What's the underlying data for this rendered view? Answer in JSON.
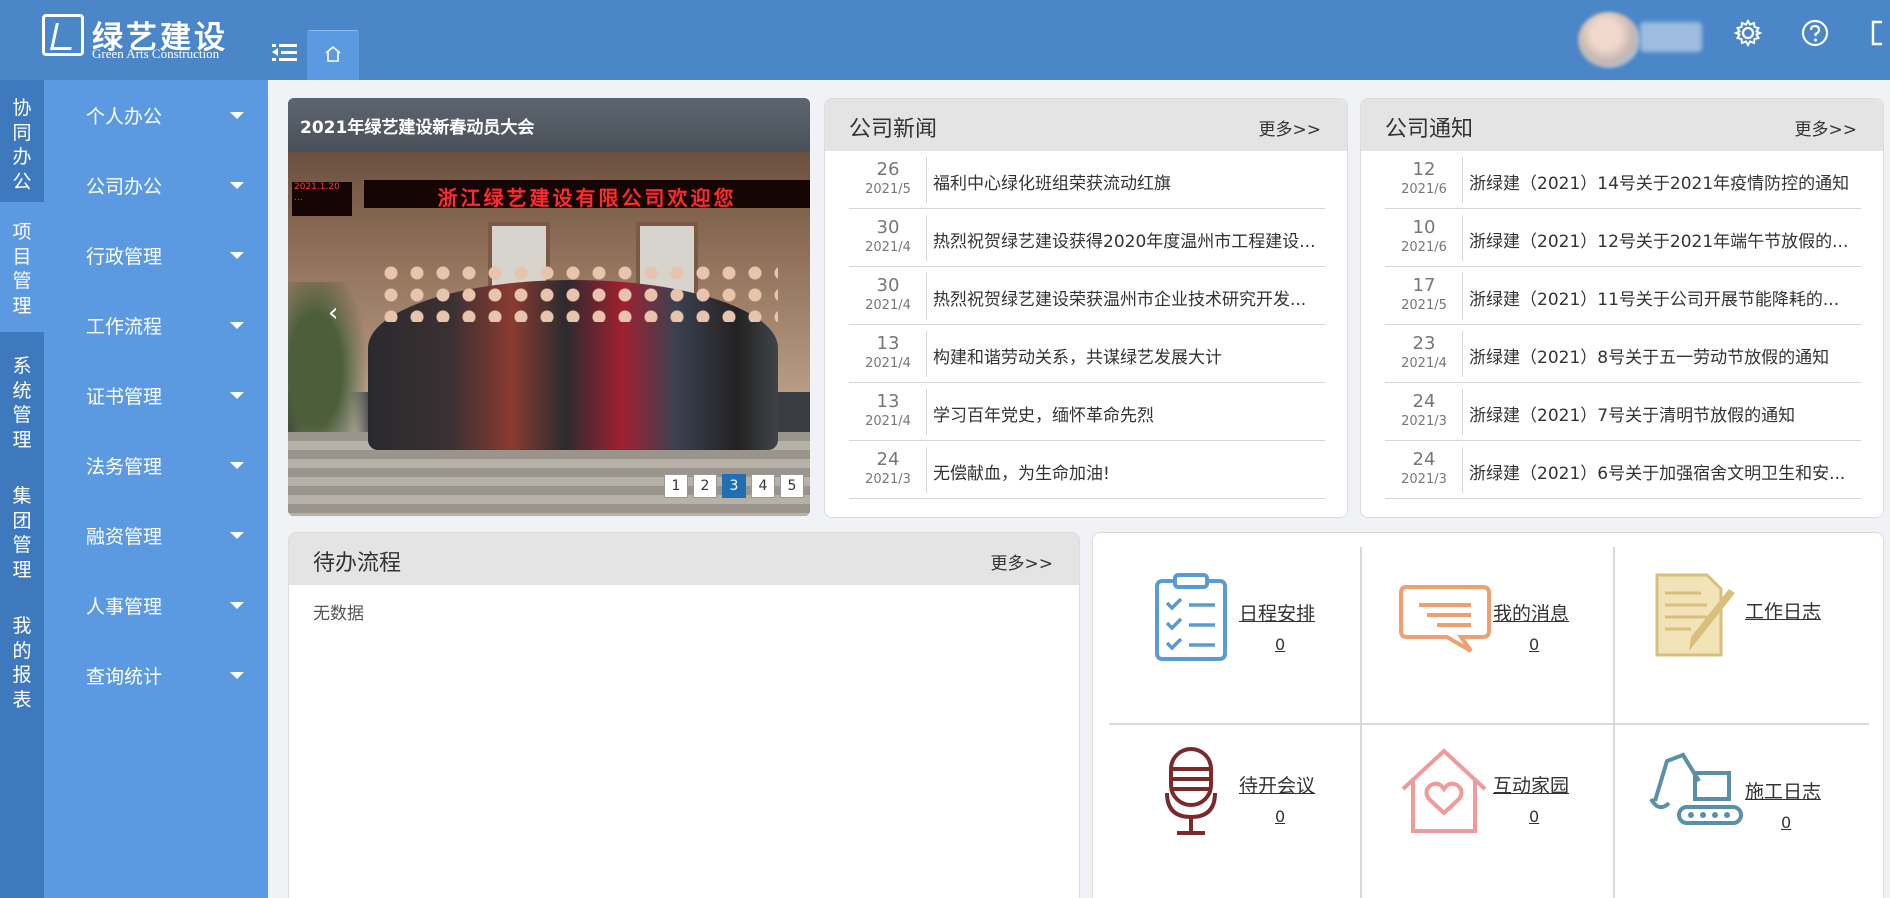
{
  "header": {
    "logo_cn": "绿艺建设",
    "logo_en": "Green Arts Construction",
    "home_tab_icon": "home-icon"
  },
  "left_nav": [
    "协同办公",
    "项目管理",
    "系统管理",
    "集团管理",
    "我的报表"
  ],
  "sub_nav": [
    "个人办公",
    "公司办公",
    "行政管理",
    "工作流程",
    "证书管理",
    "法务管理",
    "融资管理",
    "人事管理",
    "查询统计"
  ],
  "carousel": {
    "title": "2021年绿艺建设新春动员大会",
    "banner": "浙江绿艺建设有限公司欢迎您",
    "small_banner": "2021.1.20 ...",
    "pages": [
      "1",
      "2",
      "3",
      "4",
      "5"
    ],
    "active_page": 3
  },
  "news": {
    "title": "公司新闻",
    "more": "更多>>",
    "items": [
      {
        "day": "26",
        "ym": "2021/5",
        "text": "福利中心绿化班组荣获流动红旗"
      },
      {
        "day": "30",
        "ym": "2021/4",
        "text": "热烈祝贺绿艺建设获得2020年度温州市工程建设..."
      },
      {
        "day": "30",
        "ym": "2021/4",
        "text": "热烈祝贺绿艺建设荣获温州市企业技术研究开发..."
      },
      {
        "day": "13",
        "ym": "2021/4",
        "text": "构建和谐劳动关系，共谋绿艺发展大计"
      },
      {
        "day": "13",
        "ym": "2021/4",
        "text": "学习百年党史，缅怀革命先烈"
      },
      {
        "day": "24",
        "ym": "2021/3",
        "text": "无偿献血，为生命加油!"
      }
    ]
  },
  "notice": {
    "title": "公司通知",
    "more": "更多>>",
    "items": [
      {
        "day": "12",
        "ym": "2021/6",
        "text": "浙绿建（2021）14号关于2021年疫情防控的通知"
      },
      {
        "day": "10",
        "ym": "2021/6",
        "text": "浙绿建（2021）12号关于2021年端午节放假的..."
      },
      {
        "day": "17",
        "ym": "2021/5",
        "text": "浙绿建（2021）11号关于公司开展节能降耗的..."
      },
      {
        "day": "23",
        "ym": "2021/4",
        "text": "浙绿建（2021）8号关于五一劳动节放假的通知"
      },
      {
        "day": "24",
        "ym": "2021/3",
        "text": "浙绿建（2021）7号关于清明节放假的通知"
      },
      {
        "day": "24",
        "ym": "2021/3",
        "text": "浙绿建（2021）6号关于加强宿舍文明卫生和安..."
      }
    ]
  },
  "todo": {
    "title": "待办流程",
    "more": "更多>>",
    "empty": "无数据"
  },
  "quick_links": [
    {
      "label": "日程安排",
      "count": "0",
      "icon": "clipboard-checklist-icon",
      "color": "#5b9bd5"
    },
    {
      "label": "我的消息",
      "count": "0",
      "icon": "chat-bubble-icon",
      "color": "#f0a070"
    },
    {
      "label": "工作日志",
      "count": "",
      "icon": "document-pen-icon",
      "color": "#d8bf7a"
    },
    {
      "label": "待开会议",
      "count": "0",
      "icon": "microphone-icon",
      "color": "#7a2a2a"
    },
    {
      "label": "互动家园",
      "count": "0",
      "icon": "house-heart-icon",
      "color": "#f09a9a"
    },
    {
      "label": "施工日志",
      "count": "0",
      "icon": "excavator-icon",
      "color": "#5a8fa8"
    }
  ],
  "colors": {
    "header": "#4a86c8",
    "left_nav": "#3f79bd",
    "sub_nav": "#5b9ae0",
    "active_dot": "#1f6fb2"
  }
}
